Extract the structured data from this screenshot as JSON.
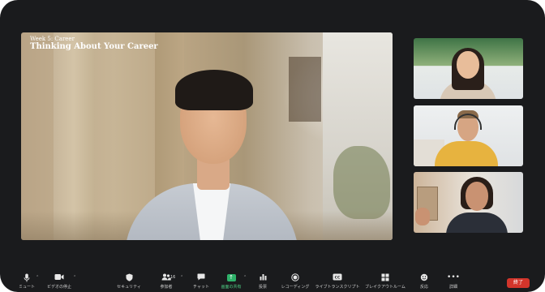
{
  "main_video": {
    "subtitle": "Week 5: Career",
    "title": "Thinking About Your Career"
  },
  "toolbar": {
    "items": [
      {
        "label": "ミュート",
        "icon": "microphone-icon"
      },
      {
        "label": "ビデオの停止",
        "icon": "video-camera-icon"
      },
      {
        "label": "セキュリティ",
        "icon": "shield-icon"
      },
      {
        "label": "参加者",
        "icon": "participants-icon"
      },
      {
        "label": "チャット",
        "icon": "chat-icon"
      },
      {
        "label": "画面の共有",
        "icon": "share-screen-icon"
      },
      {
        "label": "投票",
        "icon": "poll-icon"
      },
      {
        "label": "レコーディング",
        "icon": "record-icon"
      },
      {
        "label": "ライブトランスクリプト",
        "icon": "cc-icon"
      },
      {
        "label": "ブレイクアウトルーム",
        "icon": "breakout-icon"
      },
      {
        "label": "反応",
        "icon": "reaction-icon"
      },
      {
        "label": "詳細",
        "icon": "more-icon"
      }
    ],
    "participant_count": "16",
    "end_label": "終了"
  },
  "colors": {
    "window_bg": "#1a1b1d",
    "share_green": "#2fb26a",
    "end_red": "#d2352b"
  }
}
